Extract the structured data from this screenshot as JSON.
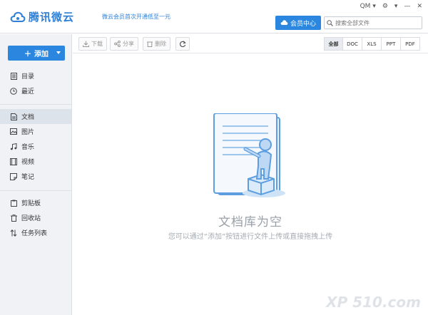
{
  "app": {
    "logo_text": "腾讯微云",
    "promo": "微云会员首次开通低至一元",
    "user": "QM",
    "vip_label": "会员中心",
    "search_placeholder": "搜索全部文件"
  },
  "sidebar": {
    "add_label": "添加",
    "group1": [
      {
        "label": "目录",
        "icon": "list-icon"
      },
      {
        "label": "最近",
        "icon": "clock-icon"
      }
    ],
    "group2": [
      {
        "label": "文档",
        "icon": "document-icon",
        "active": true
      },
      {
        "label": "图片",
        "icon": "image-icon"
      },
      {
        "label": "音乐",
        "icon": "music-icon"
      },
      {
        "label": "视频",
        "icon": "video-icon"
      },
      {
        "label": "笔记",
        "icon": "note-icon"
      }
    ],
    "group3": [
      {
        "label": "剪贴板",
        "icon": "clipboard-icon"
      },
      {
        "label": "回收站",
        "icon": "trash-icon"
      },
      {
        "label": "任务列表",
        "icon": "transfer-icon"
      }
    ]
  },
  "toolbar": {
    "download": "下载",
    "share": "分享",
    "delete": "删除",
    "filters": [
      "全部",
      "DOC",
      "XLS",
      "PPT",
      "PDF"
    ],
    "active_filter": "全部"
  },
  "empty": {
    "title": "文档库为空",
    "subtitle": "您可以通过“添加”按钮进行文件上传或直接拖拽上传"
  },
  "watermark": "XP 510.com"
}
